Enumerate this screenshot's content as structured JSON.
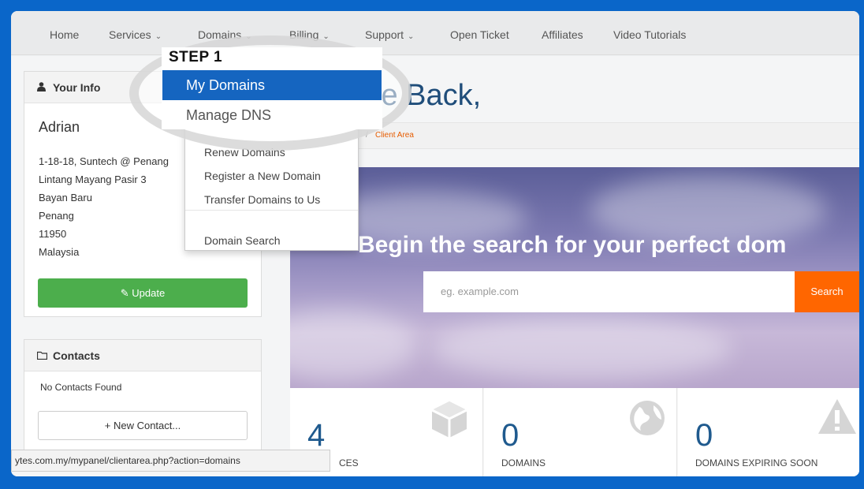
{
  "nav": {
    "items": [
      {
        "label": "Home",
        "caret": false
      },
      {
        "label": "Services",
        "caret": true
      },
      {
        "label": "Domains",
        "caret": true
      },
      {
        "label": "Billing",
        "caret": true
      },
      {
        "label": "Support",
        "caret": true
      },
      {
        "label": "Open Ticket",
        "caret": false
      },
      {
        "label": "Affiliates",
        "caret": false
      },
      {
        "label": "Video Tutorials",
        "caret": false
      }
    ],
    "caret_glyph": "⌄"
  },
  "your_info": {
    "title": "Your Info",
    "icon": "user-icon",
    "name": "Adrian",
    "address": [
      "1-18-18, Suntech @ Penang",
      "Lintang Mayang Pasir 3",
      "Bayan Baru",
      "Penang",
      "11950",
      "Malaysia"
    ],
    "update_label": "Update"
  },
  "contacts": {
    "title": "Contacts",
    "icon": "folder-icon",
    "empty_text": "No Contacts Found",
    "new_contact_label": "+ New Contact..."
  },
  "main": {
    "welcome": "ie Back,",
    "breadcrumb_sep": "/",
    "breadcrumb": "Client Area",
    "hero_title": "Begin the search for your perfect dom",
    "search_placeholder": "eg. example.com",
    "search_button": "Search"
  },
  "stats": [
    {
      "value": "4",
      "label": "CES",
      "icon": "box-icon"
    },
    {
      "value": "0",
      "label": "DOMAINS",
      "icon": "globe-icon"
    },
    {
      "value": "0",
      "label": "DOMAINS EXPIRING SOON",
      "icon": "warning-icon"
    }
  ],
  "domains_menu": {
    "items": [
      "Renew Domains",
      "Register a New Domain",
      "Transfer Domains to Us",
      "Domain Search"
    ]
  },
  "step": {
    "label": "STEP 1",
    "highlight": "My Domains",
    "next": "Manage DNS"
  },
  "statusbar": "ytes.com.my/mypanel/clientarea.php?action=domains",
  "colors": {
    "frame_blue": "#0a66c9",
    "highlight_blue": "#1565c0",
    "update_green": "#4cae4c",
    "search_orange": "#ff6600",
    "title_blue": "#1f4d7a"
  }
}
